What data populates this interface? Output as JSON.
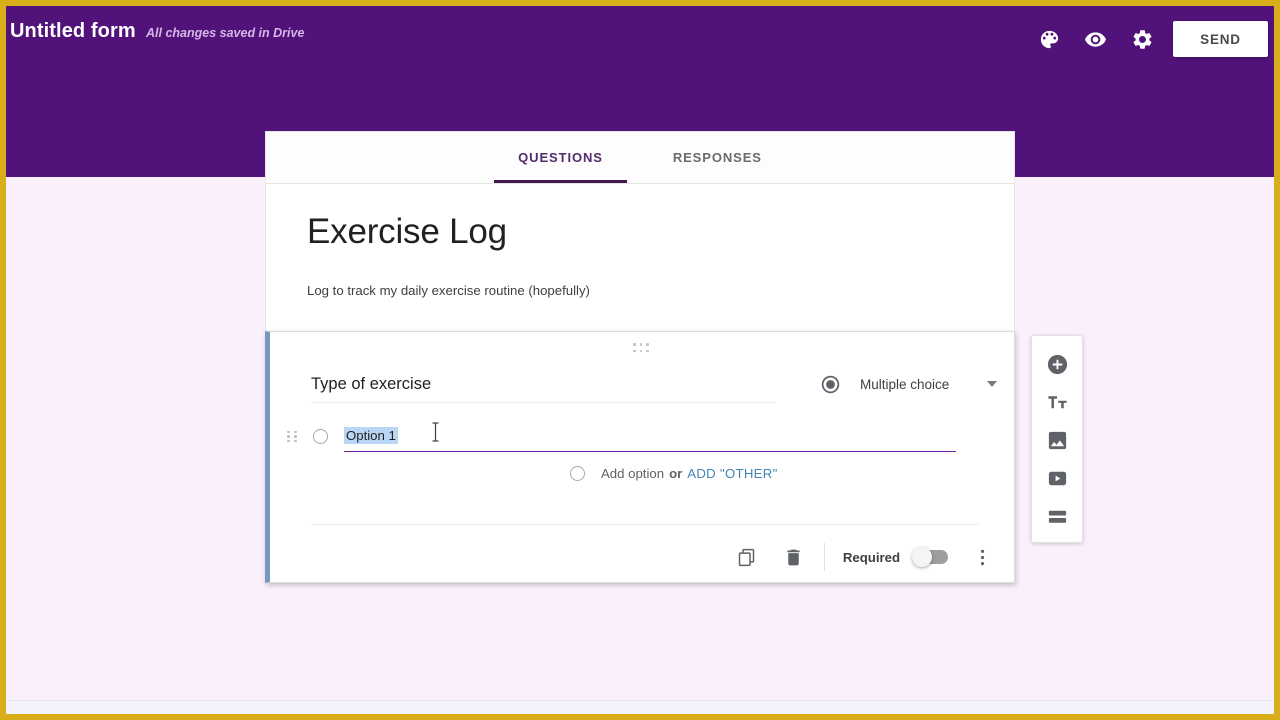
{
  "appbar": {
    "doc_title": "Untitled form",
    "save_state": "All changes saved in Drive",
    "send_label": "SEND",
    "icons": {
      "theme": "palette-icon",
      "preview": "eye-icon",
      "settings": "gear-icon"
    },
    "background_color": "#511379"
  },
  "tabs": [
    {
      "label": "QUESTIONS",
      "active": true
    },
    {
      "label": "RESPONSES",
      "active": false
    }
  ],
  "form": {
    "title": "Exercise Log",
    "description": "Log to track my daily exercise routine (hopefully)"
  },
  "question": {
    "title": "Type of exercise",
    "type_label": "Multiple choice",
    "type_icon": "radio-button-icon",
    "options": [
      {
        "text": "Option 1",
        "selected_text": true
      }
    ],
    "add_option_label": "Add option",
    "add_option_or": "or",
    "add_other_label": "ADD \"OTHER\"",
    "footer": {
      "duplicate_icon": "duplicate-icon",
      "delete_icon": "trash-icon",
      "required_label": "Required",
      "required_on": false,
      "more_icon": "more-vertical-icon"
    },
    "accent_color": "#7799c0",
    "focus_underline_color": "#7b1fa2",
    "selection_color": "#b9d7f5"
  },
  "side_toolbar": {
    "items": [
      {
        "name": "add-question-icon"
      },
      {
        "name": "add-title-icon"
      },
      {
        "name": "add-image-icon"
      },
      {
        "name": "add-video-icon"
      },
      {
        "name": "add-section-icon"
      }
    ]
  }
}
